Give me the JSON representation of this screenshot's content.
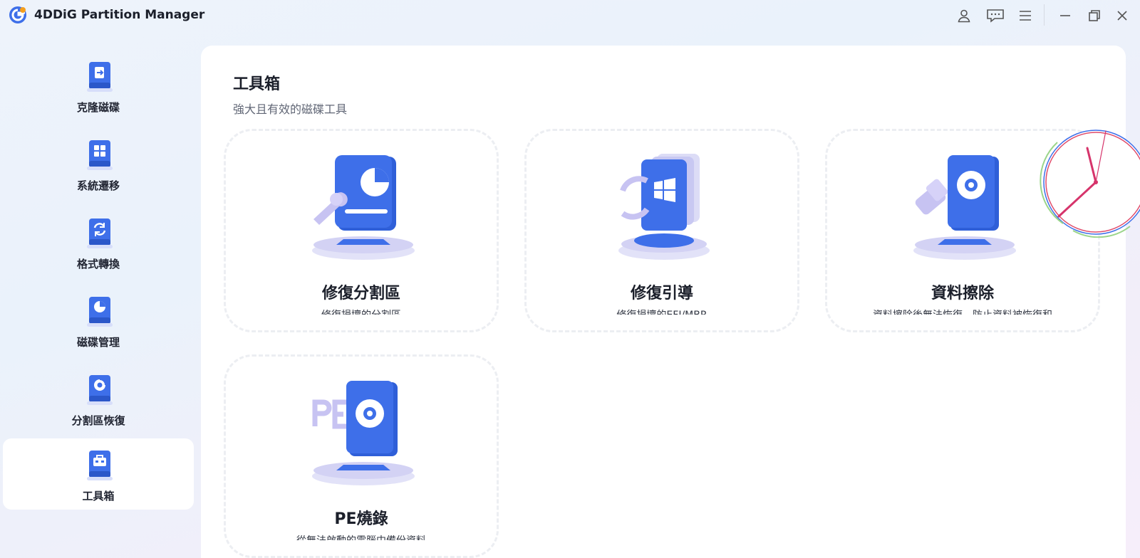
{
  "app": {
    "title": "4DDiG Partition Manager",
    "brand_colors": {
      "primary": "#3e6fe9",
      "accent": "#f59f1d",
      "sidebar_active_bg": "#ffffff"
    }
  },
  "window_controls": {
    "icons": [
      "user-icon",
      "feedback-icon",
      "menu-icon",
      "minimize-icon",
      "restore-icon",
      "close-icon"
    ]
  },
  "sidebar": {
    "active_index": 5,
    "items": [
      {
        "label": "克隆磁碟",
        "icon": "clone-disk-icon"
      },
      {
        "label": "系統遷移",
        "icon": "system-migration-icon"
      },
      {
        "label": "格式轉換",
        "icon": "format-convert-icon"
      },
      {
        "label": "磁碟管理",
        "icon": "disk-management-icon"
      },
      {
        "label": "分割區恢復",
        "icon": "partition-recovery-icon"
      },
      {
        "label": "工具箱",
        "icon": "toolbox-icon"
      }
    ]
  },
  "main": {
    "title": "工具箱",
    "subtitle": "強大且有效的磁碟工具",
    "tools": [
      {
        "title": "修復分割區",
        "desc": "修復損壞的分割區",
        "icon": "repair-partition-icon"
      },
      {
        "title": "修復引導",
        "desc": "修復損壞的EFI/MBR",
        "icon": "repair-boot-icon"
      },
      {
        "title": "資料擦除",
        "desc": "資料擦除後無法恢復，防止資料被恢復和",
        "icon": "data-wipe-icon"
      },
      {
        "title": "PE燒錄",
        "desc": "從無法啟動的電腦中備份資料",
        "icon": "pe-burn-icon"
      }
    ]
  },
  "overlay": {
    "icon": "clock-icon"
  }
}
